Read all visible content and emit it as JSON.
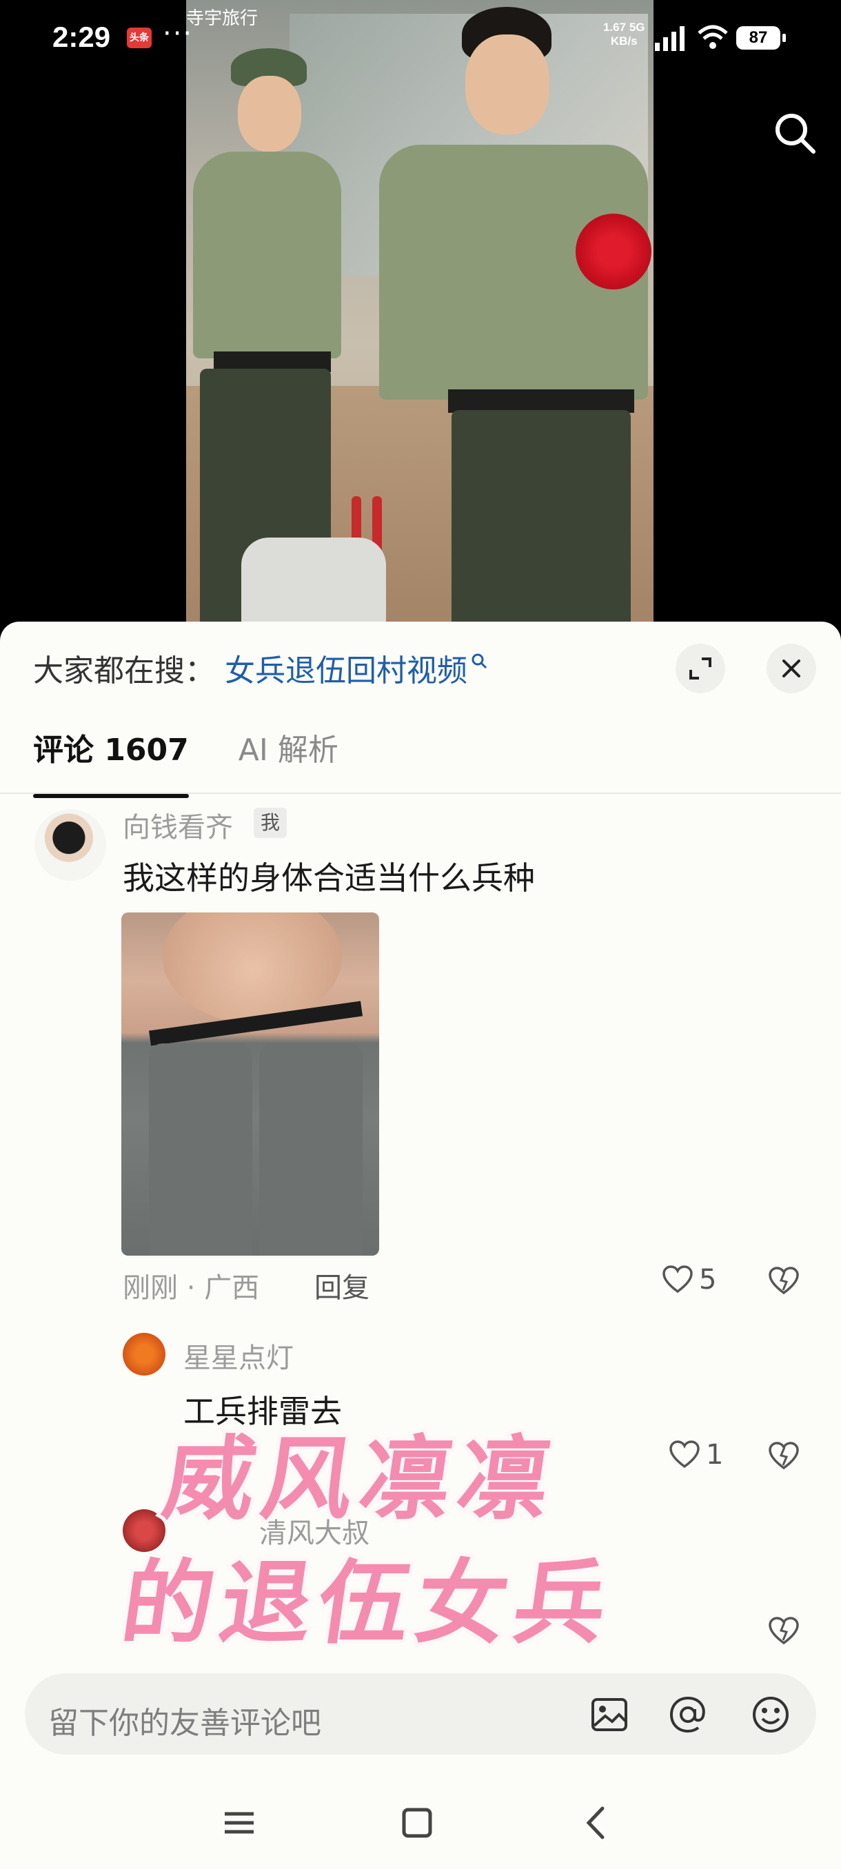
{
  "status_bar": {
    "time": "2:29",
    "notification_badge": "头条",
    "more": "···",
    "top_fragment": "寺宇旅行",
    "net_speed_value": "1.67",
    "net_speed_unit": "KB/s",
    "network_type": "5G",
    "battery": "87"
  },
  "suggest": {
    "label": "大家都在搜：",
    "query": "女兵退伍回村视频"
  },
  "tabs": [
    {
      "label": "评论 1607",
      "active": true
    },
    {
      "label": "AI 解析",
      "active": false
    }
  ],
  "comment_main": {
    "user": "向钱看齐",
    "badge": "我",
    "text": "我这样的身体合适当什么兵种",
    "meta": "刚刚 · 广西",
    "reply": "回复",
    "likes": "5"
  },
  "reply_1": {
    "user": "星星点灯",
    "text": "工兵排雷去",
    "likes": "1"
  },
  "reply_2": {
    "user": "清风大叔"
  },
  "overlay": {
    "line1": "威风凛凛",
    "line2": "的退伍女兵"
  },
  "input": {
    "placeholder": "留下你的友善评论吧"
  },
  "icons": {
    "search": "search-icon",
    "expand": "expand-icon",
    "close": "close-icon",
    "image": "image-icon",
    "mention": "at-icon",
    "emoji": "emoji-icon",
    "nav_menu": "menu-icon",
    "nav_home": "home-icon",
    "nav_back": "back-icon"
  },
  "colors": {
    "link": "#1f5ea9",
    "overlay_text": "#f48cb0",
    "panel_bg": "#fcfcf8"
  }
}
